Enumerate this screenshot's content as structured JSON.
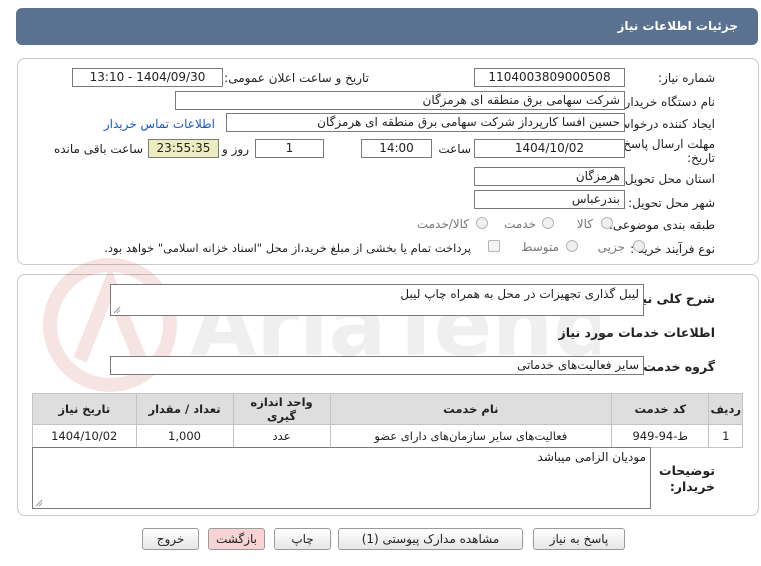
{
  "header": {
    "title": "جزئیات اطلاعات نیاز"
  },
  "form": {
    "need_number_label": "شماره نیاز:",
    "need_number": "1104003809000508",
    "announce_label": "تاریخ و ساعت اعلان عمومی:",
    "announce_value": "1404/09/30 - 13:10",
    "buyer_org_label": "نام دستگاه خریدار:",
    "buyer_org": "شرکت سهامی برق منطقه ای هرمزگان",
    "requester_label": "ایجاد کننده درخواست:",
    "requester": "حسین افسا کارپرداز شرکت سهامی برق منطقه ای هرمزگان",
    "contact_link": "اطلاعات تماس خریدار",
    "deadline_label_1": "مهلت ارسال پاسخ: تا",
    "deadline_label_2": "تاریخ:",
    "deadline_date": "1404/10/02",
    "time_label": "ساعت",
    "deadline_time": "14:00",
    "days_value": "1",
    "days_label": "روز و",
    "remaining_time": "23:55:35",
    "remaining_label": "ساعت باقی مانده",
    "province_label": "استان محل تحویل:",
    "province": "هرمزگان",
    "city_label": "شهر محل تحویل:",
    "city": "بندرعباس",
    "category_label": "طبقه بندی موضوعی:",
    "category_options": [
      "کالا",
      "خدمت",
      "کالا/خدمت"
    ],
    "process_label": "نوع فرآیند خرید :",
    "process_options": [
      "جزیی",
      "متوسط"
    ],
    "payment_note": "پرداخت تمام یا بخشی از مبلغ خرید،از محل \"اسناد خزانه اسلامی\" خواهد بود."
  },
  "details": {
    "description_label": "شرح کلی نیاز:",
    "description": "لیبل گذاری تجهیزات در محل به همراه چاپ لیبل",
    "services_title": "اطلاعات خدمات مورد نیاز",
    "service_group_label": "گروه خدمت:",
    "service_group": "سایر فعالیت‌های خدماتی",
    "table": {
      "headers": [
        "ردیف",
        "کد خدمت",
        "نام خدمت",
        "واحد اندازه گیری",
        "تعداد / مقدار",
        "تاریخ نیاز"
      ],
      "rows": [
        [
          "1",
          "ط-94-949",
          "فعالیت‌های سایر سازمان‌های دارای عضو",
          "عدد",
          "1,000",
          "1404/10/02"
        ]
      ]
    },
    "buyer_notes_label_1": "توضیحات",
    "buyer_notes_label_2": "خریدار:",
    "buyer_notes": "مودیان الزامی میباشد"
  },
  "buttons": {
    "reply": "پاسخ به نیاز",
    "attachments": "مشاهده مدارک پیوستی (1)",
    "print": "چاپ",
    "back": "بازگشت",
    "exit": "خروج"
  },
  "colors": {
    "header_bg": "#5a7190",
    "link": "#1a57c4",
    "table_header_bg": "#dedede",
    "pink_button": "#f7d3d3"
  }
}
